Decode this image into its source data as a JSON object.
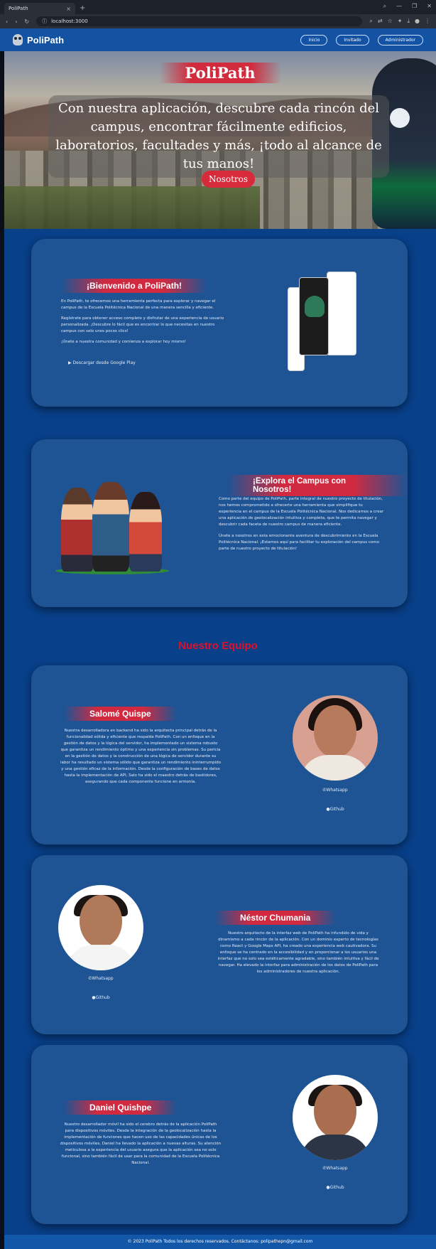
{
  "browser": {
    "tab_title": "PoliPath",
    "url": "localhost:3000",
    "new_tab": "+",
    "close": "×"
  },
  "nav": {
    "brand": "PoliPath",
    "links": [
      "Inicio",
      "Invitado",
      "Administrador"
    ]
  },
  "hero": {
    "title": "PoliPath",
    "text": "Con nuestra aplicación, descubre cada rincón del campus, encontrar fácilmente edificios, laboratorios, facultades y más, ¡todo al alcance de tus manos!",
    "button": "Nosotros"
  },
  "welcome": {
    "title": "¡Bienvenido a PoliPath!",
    "paragraphs": [
      "En PoliPath, te ofrecemos una herramienta perfecta para explorar y navegar el campus de la Escuela Politécnica Nacional de una manera sencilla y eficiente.",
      "Regístrate para obtener acceso completo y disfrutar de una experiencia de usuario personalizada. ¡Descubre lo fácil que es encontrar lo que necesitas en nuestro campus con solo unos pocos clics!",
      "¡Únete a nuestra comunidad y comienza a explorar hoy mismo!"
    ],
    "google_play": "Descargar desde Google Play"
  },
  "explore": {
    "title": "¡Explora el Campus con Nosotros!",
    "paragraphs": [
      "Como parte del equipo de PoliPath, parte integral de nuestro proyecto de titulación, nos hemos comprometido a ofrecerte una herramienta que simplifique tu experiencia en el campus de la Escuela Politécnica Nacional. Nos dedicamos a crear una aplicación de geolocalización intuitiva y completa, que te permita navegar y descubrir cada faceta de nuestro campus de manera eficiente.",
      "Únete a nosotros en esta emocionante aventura de descubrimiento en la Escuela Politécnica Nacional. ¡Estamos aquí para facilitar tu exploración del campus como parte de nuestro proyecto de titulación!"
    ]
  },
  "team_title": "Nuestro Equipo",
  "members": [
    {
      "name": "Salomé Quispe",
      "bio": "Nuestra desarrolladora en backend ha sido la arquitecta principal detrás de la funcionalidad sólida y eficiente que respalda PoliPath. Con un enfoque en la gestión de datos y la lógica del servidor, ha implementado un sistema robusto que garantiza un rendimiento óptimo y una experiencia sin problemas. Su pericia en la gestión de datos y la construcción de una lógica de servidor durante su labor ha resultado un sistema sólido que garantiza un rendimiento ininterrumpido y una gestión eficaz de la información. Desde la configuración de bases de datos hasta la implementación de API, Salo ha sido el maestro detrás de bastidores, asegurando que cada componente funcione en armonía.",
      "whatsapp": "Whatsapp",
      "github": "Github"
    },
    {
      "name": "Néstor Chumania",
      "bio": "Nuestro arquitecto de la interfaz web de PoliPath ha infundido de vida y dinamismo a cada rincón de la aplicación. Con un dominio experto de tecnologías como React y Google Maps API, ha creado una experiencia web cautivadora. Su enfoque se ha centrado en la accesibilidad y en proporcionar a los usuarios una interfaz que no solo sea estéticamente agradable, sino también intuitiva y fácil de navegar. Ha elevado la interfaz para administración de los datos de PoliPath para los administradores de nuestra aplicación.",
      "whatsapp": "Whatsapp",
      "github": "Github"
    },
    {
      "name": "Daniel Quishpe",
      "bio": "Nuestro desarrollador móvil ha sido el cerebro detrás de la aplicación PoliPath para dispositivos móviles. Desde la integración de la geolocalización hasta la implementación de funciones que hacen uso de las capacidades únicas de los dispositivos móviles, Daniel ha llevado la aplicación a nuevas alturas. Su atención meticulosa a la experiencia del usuario asegura que la aplicación sea no solo funcional, sino también fácil de usar para la comunidad de la Escuela Politécnica Nacional.",
      "whatsapp": "Whatsapp",
      "github": "Github"
    }
  ],
  "footer": "© 2023 PoliPath Todos los derechos reservados. Contáctanos: polipathepn@gmail.com"
}
